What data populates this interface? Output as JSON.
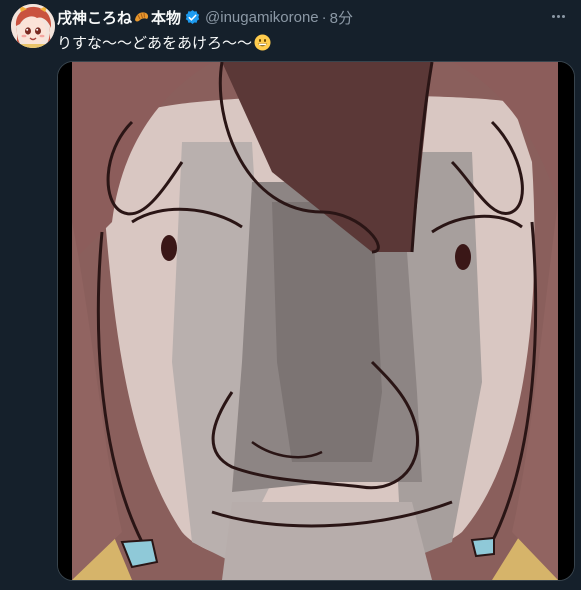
{
  "tweet": {
    "display_name": "戌神ころね",
    "name_suffix": "本物",
    "handle": "@inugamikorone",
    "separator": "·",
    "timestamp": "8分",
    "text": "りすな〜〜どあをあけろ〜〜"
  },
  "icons": {
    "avatar": "avatar-image",
    "croissant": "croissant-emoji",
    "verified": "verified-badge-icon",
    "more": "more-horizontal-icon",
    "smiley": "grinning-face-emoji"
  },
  "colors": {
    "background": "#15202b",
    "verified": "#1d9bf0",
    "secondary_text": "#8b98a5"
  }
}
